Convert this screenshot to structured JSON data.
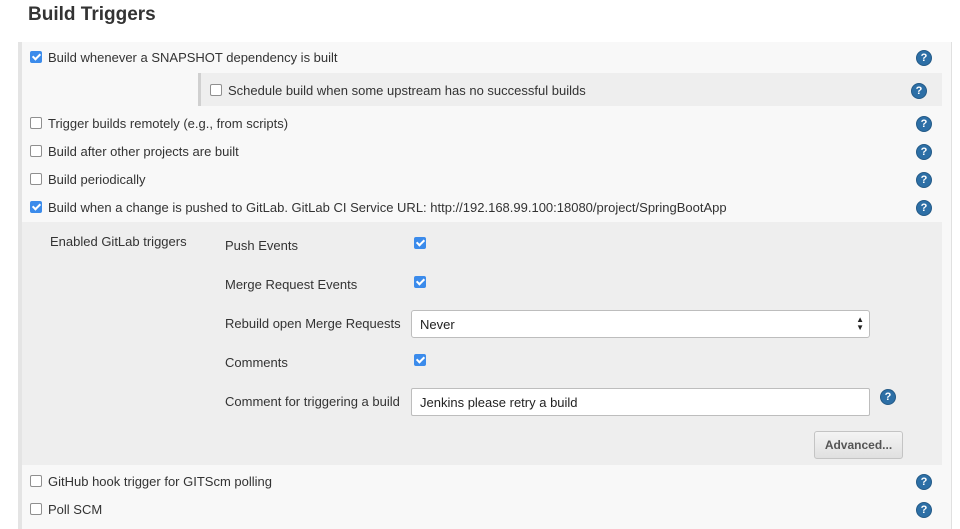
{
  "section": {
    "title": "Build Triggers"
  },
  "triggers": [
    {
      "label": "Build whenever a SNAPSHOT dependency is built",
      "checked": true
    },
    {
      "label": "Trigger builds remotely (e.g., from scripts)",
      "checked": false
    },
    {
      "label": "Build after other projects are built",
      "checked": false
    },
    {
      "label": "Build periodically",
      "checked": false
    },
    {
      "label": "Build when a change is pushed to GitLab. GitLab CI Service URL: http://192.168.99.100:18080/project/SpringBootApp",
      "checked": true
    },
    {
      "label": "GitHub hook trigger for GITScm polling",
      "checked": false
    },
    {
      "label": "Poll SCM",
      "checked": false
    }
  ],
  "snapshot_sub": {
    "label": "Schedule build when some upstream has no successful builds",
    "checked": false
  },
  "gitlab": {
    "enabled_label": "Enabled GitLab triggers",
    "push_events": {
      "label": "Push Events",
      "checked": true
    },
    "merge_request_events": {
      "label": "Merge Request Events",
      "checked": true
    },
    "rebuild": {
      "label": "Rebuild open Merge Requests",
      "value": "Never"
    },
    "comments": {
      "label": "Comments",
      "checked": true
    },
    "comment_trigger": {
      "label": "Comment for triggering a build",
      "value": "Jenkins please retry a build"
    },
    "advanced_label": "Advanced..."
  },
  "help_icon_glyph": "?",
  "colors": {
    "accent": "#3b8beb",
    "help": "#2d6fa6"
  }
}
